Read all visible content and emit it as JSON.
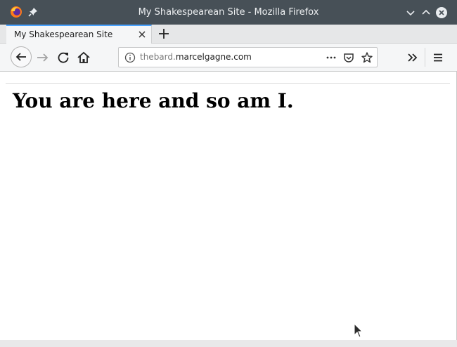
{
  "window": {
    "title": "My Shakespearean Site - Mozilla Firefox"
  },
  "tabs": [
    {
      "label": "My Shakespearean Site",
      "active": true
    }
  ],
  "urlbar": {
    "url_subdomain": "thebard.",
    "url_domain": "marcelgagne.com"
  },
  "page": {
    "heading": "You are here and so am I."
  },
  "colors": {
    "titlebar": "#475057",
    "tab_accent": "#4aa3ff",
    "toolbar": "#f5f6f7"
  },
  "icons": {
    "app": "firefox-logo",
    "pin": "pin-icon",
    "minimize": "chevron-down-icon",
    "maximize": "chevron-up-icon",
    "close": "close-circle-icon",
    "tab_close": "close-icon",
    "new_tab": "plus-icon",
    "back": "arrow-left-icon",
    "forward": "arrow-right-icon",
    "reload": "reload-icon",
    "home": "home-icon",
    "info": "info-icon",
    "page_actions": "more-horizontal-icon",
    "pocket": "pocket-icon",
    "bookmark": "star-icon",
    "overflow": "double-chevron-right-icon",
    "menu": "hamburger-menu-icon"
  }
}
